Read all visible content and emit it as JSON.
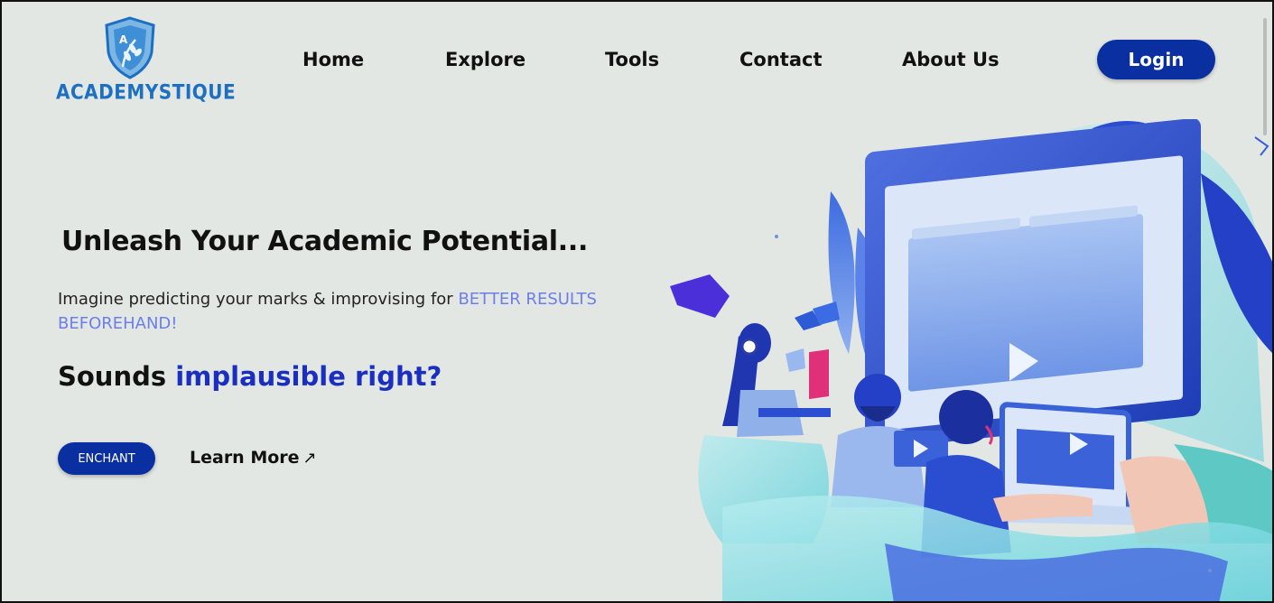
{
  "brand": {
    "name": "ACADEMYSTIQUE",
    "emblem_letter": "A",
    "color": "#1d6fc1"
  },
  "nav": {
    "items": [
      {
        "label": "Home"
      },
      {
        "label": "Explore"
      },
      {
        "label": "Tools"
      },
      {
        "label": "Contact"
      },
      {
        "label": "About Us"
      }
    ],
    "login_label": "Login"
  },
  "hero": {
    "title": "Unleash Your Academic Potential...",
    "description_plain": "Imagine predicting your marks & improvising for ",
    "description_accent": "BETTER RESULTS BEFOREHAND!",
    "question_plain": "Sounds ",
    "question_accent": "implausible right?",
    "primary_button": "ENCHANT",
    "secondary_link": "Learn More",
    "secondary_icon": "arrow-up-right-icon"
  },
  "colors": {
    "background": "#e3e7e4",
    "primary": "#0a2fa0",
    "accent_light": "#6d7ee8",
    "accent_dark": "#1a2fc0"
  }
}
